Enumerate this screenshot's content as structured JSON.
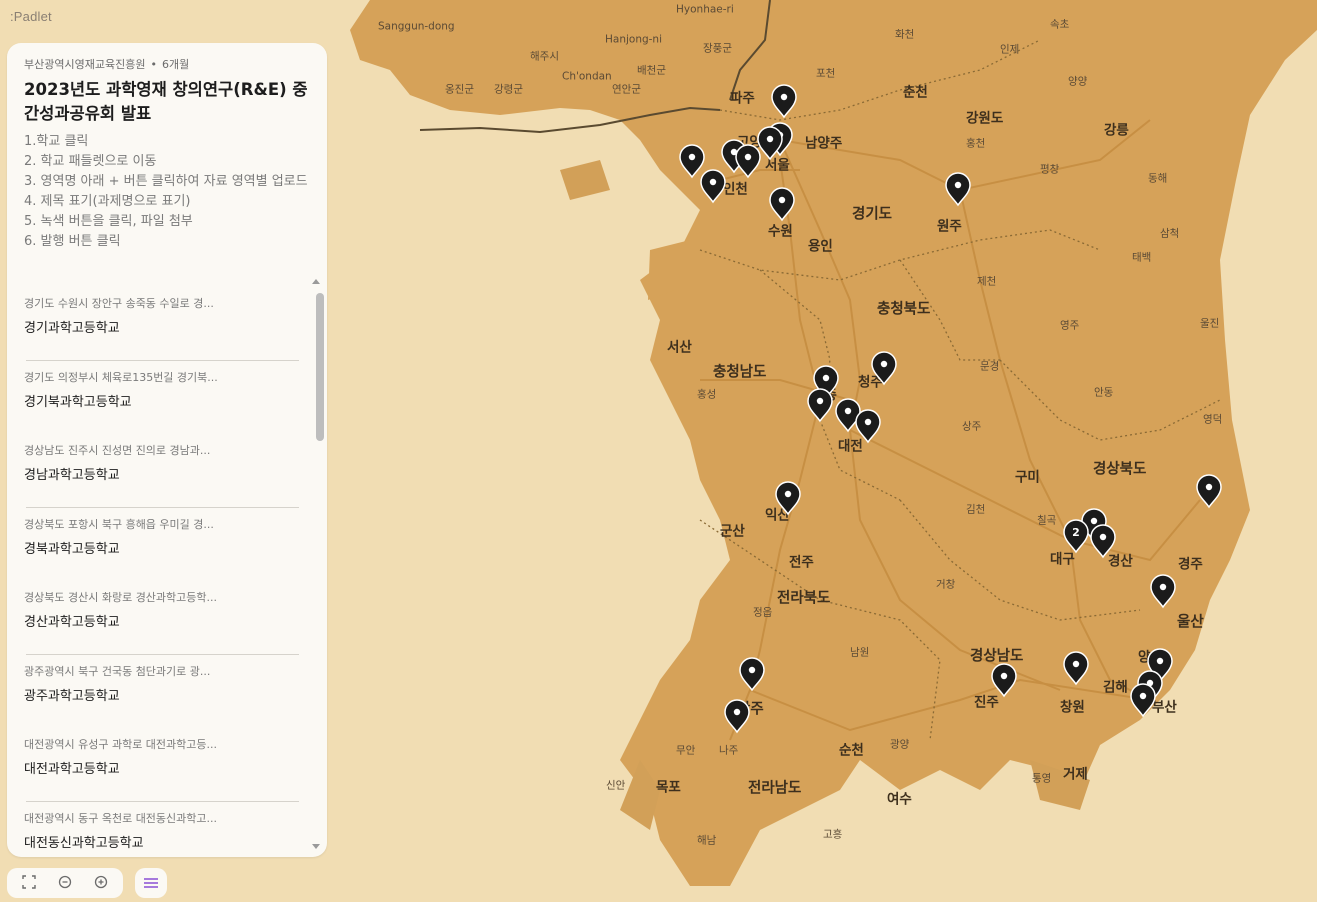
{
  "app": {
    "brand": ":Padlet"
  },
  "board": {
    "author": "부산광역시영재교육진흥원",
    "age": "6개월",
    "title": "2023년도 과학영재 창의연구(R&E) 중간성과공유회 발표",
    "description": "1.학교 클릭\n2. 학교 패들렛으로 이동\n3. 영역명 아래 + 버튼 클릭하여 자료 영역별 업로드\n4. 제목 표기(과제명으로 표기)\n5. 녹색 버튼을 클릭, 파일 첨부\n6. 발행 버튼 클릭"
  },
  "posts": [
    {
      "address": "경기도 수원시 장안구 송죽동 수일로 경...",
      "name": "경기과학고등학교"
    },
    {
      "address": "경기도 의정부시 체육로135번길 경기북...",
      "name": "경기북과학고등학교"
    },
    {
      "address": "경상남도 진주시 진성면 진의로 경남과...",
      "name": "경남과학고등학교"
    },
    {
      "address": "경상북도 포항시 북구 흥해읍 우미길 경...",
      "name": "경북과학고등학교"
    },
    {
      "address": "경상북도 경산시 화랑로 경산과학고등학...",
      "name": "경산과학고등학교"
    },
    {
      "address": "광주광역시 북구 건국동 첨단과기로 광...",
      "name": "광주과학고등학교"
    },
    {
      "address": "대전광역시 유성구 과학로 대전과학고등...",
      "name": "대전과학고등학교"
    },
    {
      "address": "대전광역시 동구 옥천로 대전동신과학고...",
      "name": "대전동신과학고등학교"
    }
  ],
  "map": {
    "land_color": "#d6a259",
    "sea_color": "#f1ddb3",
    "road_color": "#c48b3e",
    "pin_color": "#1b1b1b",
    "cluster_count": "2",
    "labels": [
      "Sanggun-dong",
      "Hyonhae-ri",
      "Hanjong-ni",
      "Ch'ondan",
      "해주시",
      "옹진군",
      "강령군",
      "배천군",
      "연안군",
      "장풍군",
      "화천",
      "인제",
      "속초",
      "양양",
      "파주",
      "포천",
      "춘천",
      "강원도",
      "강릉",
      "고양",
      "남양주",
      "홍천",
      "평창",
      "동해",
      "인천",
      "서울",
      "경기도",
      "원주",
      "수원",
      "용인",
      "삼척",
      "태백",
      "제천",
      "충청북도",
      "서산",
      "충청남도",
      "영주",
      "울진",
      "청주",
      "홍성",
      "문경",
      "안동",
      "세종",
      "대전",
      "상주",
      "영덕",
      "구미",
      "경상북도",
      "김천",
      "칠곡",
      "익산",
      "군산",
      "대구",
      "경산",
      "전주",
      "경주",
      "전라북도",
      "거창",
      "울산",
      "정읍",
      "남원",
      "경상남도",
      "양산",
      "김해",
      "광주",
      "진주",
      "창원",
      "부산",
      "무안",
      "나주",
      "순천",
      "광양",
      "신안",
      "목포",
      "전라남도",
      "통영",
      "거제",
      "여수",
      "해남",
      "고흥"
    ]
  }
}
